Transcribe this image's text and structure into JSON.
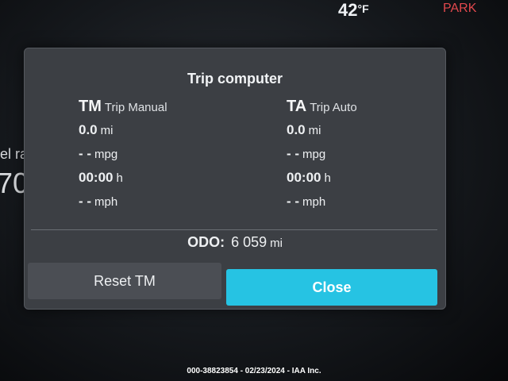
{
  "status_bar": {
    "temperature_value": "42",
    "temperature_unit": "°F",
    "gear": "PARK"
  },
  "background_partial": {
    "text": "el ra",
    "value": "70"
  },
  "dialog": {
    "title": "Trip computer",
    "trip_manual": {
      "abbr": "TM",
      "name": "Trip Manual",
      "distance": {
        "value": "0.0",
        "unit": "mi"
      },
      "economy": {
        "value": "- -",
        "unit": "mpg"
      },
      "time": {
        "value": "00:00",
        "unit": "h"
      },
      "speed": {
        "value": "- -",
        "unit": "mph"
      }
    },
    "trip_auto": {
      "abbr": "TA",
      "name": "Trip Auto",
      "distance": {
        "value": "0.0",
        "unit": "mi"
      },
      "economy": {
        "value": "- -",
        "unit": "mpg"
      },
      "time": {
        "value": "00:00",
        "unit": "h"
      },
      "speed": {
        "value": "- -",
        "unit": "mph"
      }
    },
    "odometer": {
      "label": "ODO:",
      "value": "6 059",
      "unit": "mi"
    },
    "buttons": {
      "reset": "Reset TM",
      "close": "Close"
    }
  },
  "watermark": "000-38823854 - 02/23/2024 - IAA Inc.",
  "colors": {
    "accent": "#26c3e3",
    "park": "#e2484d",
    "dialog_bg": "#3c3f44"
  }
}
